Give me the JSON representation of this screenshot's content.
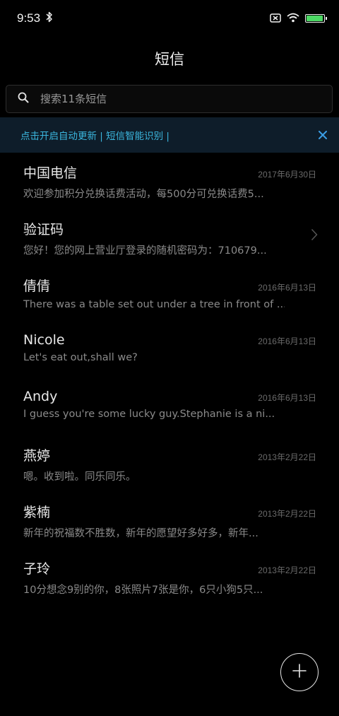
{
  "status_bar": {
    "time": "9:53",
    "icons": [
      "bluetooth-icon",
      "sim-disabled-icon",
      "wifi-icon",
      "battery-icon"
    ],
    "battery_level": 1.0,
    "battery_color": "#4cd964"
  },
  "header": {
    "title": "短信"
  },
  "search": {
    "placeholder": "搜索11条短信",
    "icon": "search-icon"
  },
  "banner": {
    "text": "点击开启自动更新 | 短信智能识别 |",
    "close_icon": "close-icon",
    "accent_color": "#3bb6de"
  },
  "messages": [
    {
      "sender": "中国电信",
      "date": "2017年6月30日",
      "preview": "欢迎参加积分兑换话费活动，每500分可兑换话费5..."
    },
    {
      "sender": "验证码",
      "date": "",
      "preview": "您好！您的网上营业厅登录的随机密码为：710679...",
      "chevron": true
    },
    {
      "sender": "倩倩",
      "date": "2016年6月13日",
      "preview": "There was a table set out under a tree in front of ..."
    },
    {
      "sender": "Nicole",
      "date": "2016年6月13日",
      "preview": "Let's eat out,shall we?"
    },
    {
      "sender": "Andy",
      "date": "2016年6月13日",
      "preview": "I guess you're some lucky guy.Stephanie is a ni..."
    },
    {
      "sender": "燕婷",
      "date": "2013年2月22日",
      "preview": "嗯。收到啦。同乐同乐。"
    },
    {
      "sender": "紫楠",
      "date": "2013年2月22日",
      "preview": "新年的祝福数不胜数，新年的愿望好多好多，新年..."
    },
    {
      "sender": "子玲",
      "date": "2013年2月22日",
      "preview": "10分想念9别的你，8张照片7张是你，6只小狗5只..."
    }
  ],
  "fab": {
    "icon": "plus-icon"
  }
}
